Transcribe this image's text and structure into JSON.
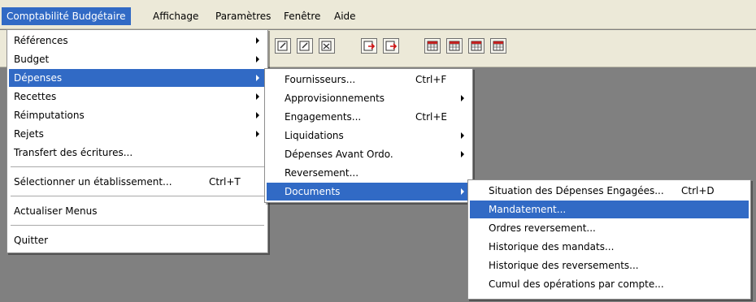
{
  "menubar": {
    "items": [
      "Comptabilité Budgétaire",
      "Affichage",
      "Paramètres",
      "Fenêtre",
      "Aide"
    ]
  },
  "toolbar": {
    "icons": [
      "edit-doc-icon",
      "edit-doc-icon",
      "edit-doc-icon",
      "arrow-doc-icon",
      "arrow-doc-icon",
      "table-icon",
      "table-icon",
      "table-icon",
      "table-icon"
    ]
  },
  "main_menu": {
    "items": [
      {
        "label": "Références"
      },
      {
        "label": "Budget"
      },
      {
        "label": "Dépenses"
      },
      {
        "label": "Recettes"
      },
      {
        "label": "Réimputations"
      },
      {
        "label": "Rejets"
      },
      {
        "label": "Transfert des écritures..."
      },
      {
        "label": "Sélectionner un établissement...",
        "shortcut": "Ctrl+T"
      },
      {
        "label": "Actualiser Menus"
      },
      {
        "label": "Quitter"
      }
    ]
  },
  "depenses_menu": {
    "items": [
      {
        "label": "Fournisseurs...",
        "shortcut": "Ctrl+F"
      },
      {
        "label": "Approvisionnements"
      },
      {
        "label": "Engagements...",
        "shortcut": "Ctrl+E"
      },
      {
        "label": "Liquidations"
      },
      {
        "label": "Dépenses Avant Ordo."
      },
      {
        "label": "Reversement..."
      },
      {
        "label": "Documents"
      }
    ]
  },
  "documents_menu": {
    "items": [
      {
        "label": "Situation des Dépenses Engagées...",
        "shortcut": "Ctrl+D"
      },
      {
        "label": "Mandatement..."
      },
      {
        "label": "Ordres reversement..."
      },
      {
        "label": "Historique des mandats..."
      },
      {
        "label": "Historique des reversements..."
      },
      {
        "label": "Cumul des opérations par compte..."
      }
    ]
  },
  "colors": {
    "highlight": "#316ac5",
    "chrome": "#ece9d8",
    "workspace": "#808080"
  }
}
